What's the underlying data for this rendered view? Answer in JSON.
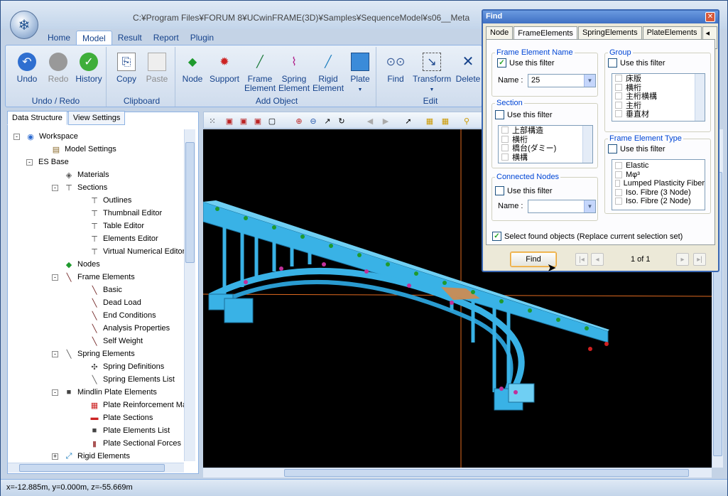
{
  "window": {
    "title": "C:¥Program Files¥FORUM 8¥UCwinFRAME(3D)¥Samples¥SequenceModel¥s06__Meta"
  },
  "tabs": [
    "Home",
    "Model",
    "Result",
    "Report",
    "Plugin"
  ],
  "ribbon": {
    "undo_redo": {
      "label": "Undo / Redo",
      "undo": "Undo",
      "redo": "Redo",
      "history": "History"
    },
    "clipboard": {
      "label": "Clipboard",
      "copy": "Copy",
      "paste": "Paste"
    },
    "add_object": {
      "label": "Add Object",
      "node": "Node",
      "support": "Support",
      "frame1": "Frame",
      "frame2": "Element",
      "spring1": "Spring",
      "spring2": "Element",
      "rigid1": "Rigid",
      "rigid2": "Element",
      "plate": "Plate"
    },
    "edit": {
      "label": "Edit",
      "find": "Find",
      "transform": "Transform",
      "delete": "Delete"
    }
  },
  "panel_tabs": [
    "Data Structure",
    "View Settings"
  ],
  "tree": [
    {
      "label": "Workspace",
      "icon": "globe-icon",
      "level": 0,
      "exp": "-"
    },
    {
      "label": "Model Settings",
      "icon": "settings-icon",
      "level": 1,
      "exp": ""
    },
    {
      "label": "ES Base",
      "icon": "",
      "level": 0.5,
      "exp": "-"
    },
    {
      "label": "Materials",
      "icon": "materials-icon",
      "level": 1.5,
      "exp": ""
    },
    {
      "label": "Sections",
      "icon": "section-icon",
      "level": 1.5,
      "exp": "-"
    },
    {
      "label": "Outlines",
      "icon": "section-icon",
      "level": 2.5,
      "exp": ""
    },
    {
      "label": "Thumbnail Editor",
      "icon": "section-icon",
      "level": 2.5,
      "exp": ""
    },
    {
      "label": "Table Editor",
      "icon": "section-icon",
      "level": 2.5,
      "exp": ""
    },
    {
      "label": "Elements Editor",
      "icon": "section-icon",
      "level": 2.5,
      "exp": ""
    },
    {
      "label": "Virtual Numerical Editor",
      "icon": "section-icon",
      "level": 2.5,
      "exp": ""
    },
    {
      "label": "Nodes",
      "icon": "node-icon",
      "level": 1.5,
      "exp": ""
    },
    {
      "label": "Frame Elements",
      "icon": "frame-icon",
      "level": 1.5,
      "exp": "-"
    },
    {
      "label": "Basic",
      "icon": "frame-icon",
      "level": 2.5,
      "exp": ""
    },
    {
      "label": "Dead Load",
      "icon": "frame-icon",
      "level": 2.5,
      "exp": ""
    },
    {
      "label": "End Conditions",
      "icon": "frame-icon",
      "level": 2.5,
      "exp": ""
    },
    {
      "label": "Analysis Properties",
      "icon": "frame-icon",
      "level": 2.5,
      "exp": ""
    },
    {
      "label": "Self Weight",
      "icon": "frame-icon",
      "level": 2.5,
      "exp": ""
    },
    {
      "label": "Spring Elements",
      "icon": "spring-icon",
      "level": 1.5,
      "exp": "-"
    },
    {
      "label": "Spring Definitions",
      "icon": "spring-def-icon",
      "level": 2.5,
      "exp": ""
    },
    {
      "label": "Spring Elements List",
      "icon": "spring-icon",
      "level": 2.5,
      "exp": ""
    },
    {
      "label": "Mindlin Plate Elements",
      "icon": "plate-icon",
      "level": 1.5,
      "exp": "-"
    },
    {
      "label": "Plate Reinforcement Materials",
      "icon": "rebar-icon",
      "level": 2.5,
      "exp": ""
    },
    {
      "label": "Plate Sections",
      "icon": "plate-section-icon",
      "level": 2.5,
      "exp": ""
    },
    {
      "label": "Plate Elements List",
      "icon": "plate-icon",
      "level": 2.5,
      "exp": ""
    },
    {
      "label": "Plate Sectional Forces",
      "icon": "plate-force-icon",
      "level": 2.5,
      "exp": ""
    },
    {
      "label": "Rigid Elements",
      "icon": "rigid-icon",
      "level": 1.5,
      "exp": "+"
    }
  ],
  "status": "x=-12.885m, y=0.000m, z=-55.669m",
  "find": {
    "title": "Find",
    "tabs": [
      "Node",
      "FrameElements",
      "SpringElements",
      "PlateElements"
    ],
    "frame_name": {
      "legend": "Frame Element Name",
      "use": "Use this filter",
      "name_label": "Name :",
      "value": "25"
    },
    "group": {
      "legend": "Group",
      "use": "Use this filter",
      "items": [
        "床版",
        "横桁",
        "主桁横構",
        "主桁",
        "垂直材"
      ]
    },
    "section": {
      "legend": "Section",
      "use": "Use this filter",
      "items": [
        "上部構造",
        "横桁",
        "橋台(ダミー)",
        "横構"
      ]
    },
    "type": {
      "legend": "Frame Element Type",
      "use": "Use this filter",
      "items": [
        "Elastic",
        "Mφ³",
        "Lumped Plasticity Fiber",
        "Iso. Fibre (3 Node)",
        "Iso. Fibre (2 Node)"
      ]
    },
    "connected": {
      "legend": "Connected Nodes",
      "use": "Use this filter",
      "name_label": "Name :",
      "value": ""
    },
    "select_found": "Select found objects (Replace current selection set)",
    "find_button": "Find",
    "page": "1 of 1"
  }
}
